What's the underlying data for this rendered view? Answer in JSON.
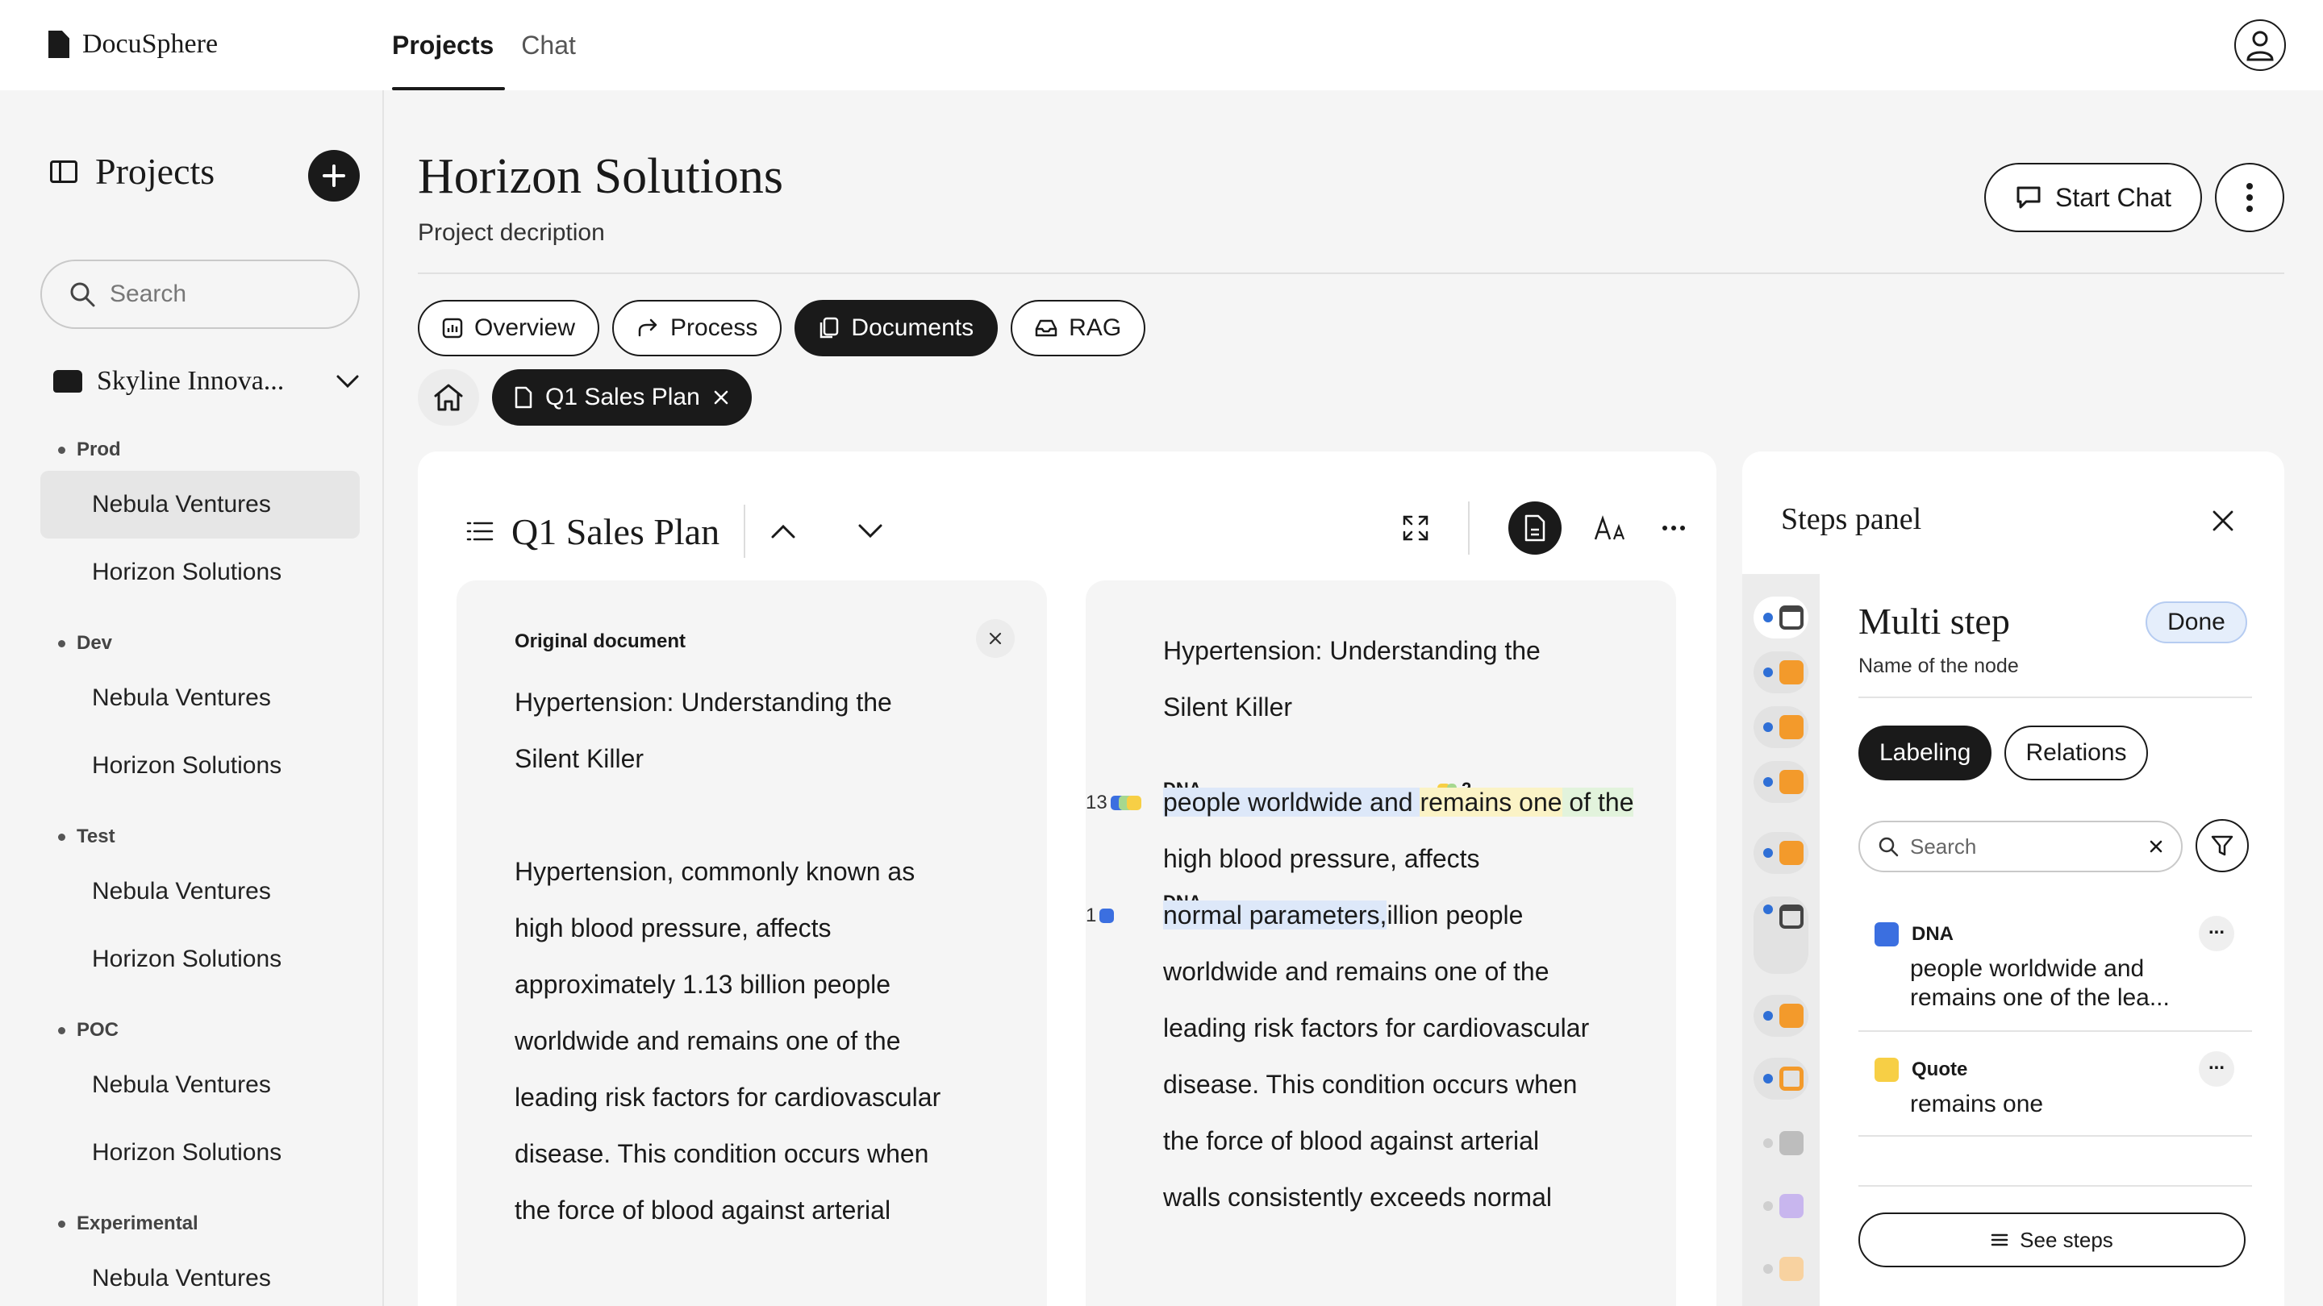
{
  "app": {
    "name": "DocuSphere"
  },
  "topnav": {
    "tabs": [
      {
        "label": "Projects"
      },
      {
        "label": "Chat"
      }
    ]
  },
  "sidebar": {
    "title": "Projects",
    "search_placeholder": "Search",
    "org": "Skyline Innova...",
    "groups": [
      {
        "label": "Prod",
        "items": [
          "Nebula Ventures",
          "Horizon Solutions"
        ]
      },
      {
        "label": "Dev",
        "items": [
          "Nebula Ventures",
          "Horizon Solutions"
        ]
      },
      {
        "label": "Test",
        "items": [
          "Nebula Ventures",
          "Horizon Solutions"
        ]
      },
      {
        "label": "POC",
        "items": [
          "Nebula Ventures",
          "Horizon Solutions"
        ]
      },
      {
        "label": "Experimental",
        "items": [
          "Nebula Ventures"
        ]
      }
    ]
  },
  "project": {
    "title": "Horizon Solutions",
    "description": "Project decription",
    "start_chat": "Start Chat"
  },
  "section_tabs": [
    {
      "label": "Overview"
    },
    {
      "label": "Process"
    },
    {
      "label": "Documents"
    },
    {
      "label": "RAG"
    }
  ],
  "breadcrumb": {
    "doc": "Q1 Sales Plan"
  },
  "document": {
    "title": "Q1 Sales Plan",
    "original_label": "Original document",
    "title_lines": [
      "Hypertension: Understanding the",
      "Silent Killer"
    ],
    "body_lines": [
      "Hypertension, commonly known as",
      "high blood pressure, affects",
      "approximately 1.13 billion people",
      "worldwide and remains one of the",
      "leading risk factors for cardiovascular",
      "disease. This condition occurs when",
      "the force of blood against arterial"
    ]
  },
  "annotated": {
    "title_lines": [
      "Hypertension: Understanding the",
      "Silent Killer"
    ],
    "line1": {
      "num": "13",
      "tag": "DNA",
      "tag2_count": "2",
      "part_blue": "people worldwide and ",
      "part_yellow": "remains one",
      "part_green": " of the"
    },
    "line2": "high blood pressure, affects",
    "line3": {
      "num": "1",
      "tag": "DNA",
      "part_blue": "normal parameters,",
      "rest": "illion people"
    },
    "rest_lines": [
      "worldwide and remains one of the",
      "leading risk factors for cardiovascular",
      "disease. This condition occurs when",
      "the force of blood against arterial",
      "walls consistently exceeds normal"
    ]
  },
  "steps_panel": {
    "title": "Steps panel",
    "node_title": "Multi step",
    "node_subtitle": "Name of the node",
    "status": "Done",
    "tabs": [
      {
        "label": "Labeling"
      },
      {
        "label": "Relations"
      }
    ],
    "search_placeholder": "Search",
    "labels": [
      {
        "type": "DNA",
        "color": "#3b6fe0",
        "text": "people worldwide and remains one of the lea..."
      },
      {
        "type": "Quote",
        "color": "#f7cf45",
        "text": "remains one"
      }
    ],
    "see_steps": "See steps"
  },
  "colors": {
    "accent": "#1a1a1a",
    "dna": "#3b6fe0",
    "quote": "#f7cf45",
    "step_orange": "#f39a2b"
  }
}
